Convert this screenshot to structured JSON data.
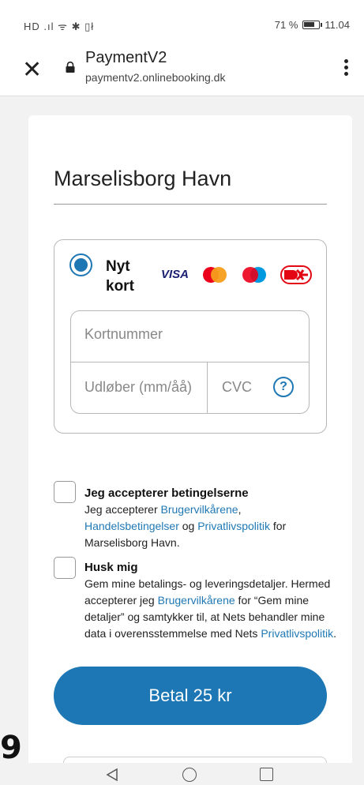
{
  "status_bar": {
    "left": "HD .ıl ᯤ ✱ ▯ł",
    "battery_pct": "71 %",
    "time": "11.04"
  },
  "browser": {
    "title": "PaymentV2",
    "url": "paymentv2.onlinebooking.dk"
  },
  "merchant": "Marselisborg Havn",
  "payment": {
    "option_label": "Nyt kort",
    "card_brands": [
      "visa-logo",
      "mastercard-logo",
      "maestro-logo",
      "dankort-logo"
    ],
    "visa_text": "VISA",
    "card_number_placeholder": "Kortnummer",
    "expiry_placeholder": "Udløber (mm/åå)",
    "cvc_placeholder": "CVC",
    "help": "?"
  },
  "terms": {
    "accept_title": "Jeg accepterer betingelserne",
    "accept_pre": "Jeg accepterer ",
    "accept_link1": "Brugervilkårene",
    "accept_sep": ",",
    "accept_link2": "Handelsbetingelser",
    "accept_and": " og ",
    "accept_link3": "Privatlivspolitik",
    "accept_post": " for Marselisborg Havn."
  },
  "remember": {
    "title": "Husk mig",
    "text_pre": "Gem mine betalings- og leveringsdetaljer. Hermed accepterer jeg ",
    "link1": "Brugervilkårene",
    "text_mid": " for “Gem mine detaljer” og samtykker til, at Nets behandler mine data i overensstemmelse med Nets ",
    "link2": "Privatlivspolitik",
    "text_post": "."
  },
  "pay_button": "Betal 25 kr",
  "overlay_digit": "9",
  "colors": {
    "accent": "#1c77b4",
    "visa": "#1a1f71",
    "mastercard_red": "#eb001b",
    "mastercard_orange": "#f79e1b",
    "maestro_blue": "#0099df",
    "dankort_red": "#e30613"
  }
}
